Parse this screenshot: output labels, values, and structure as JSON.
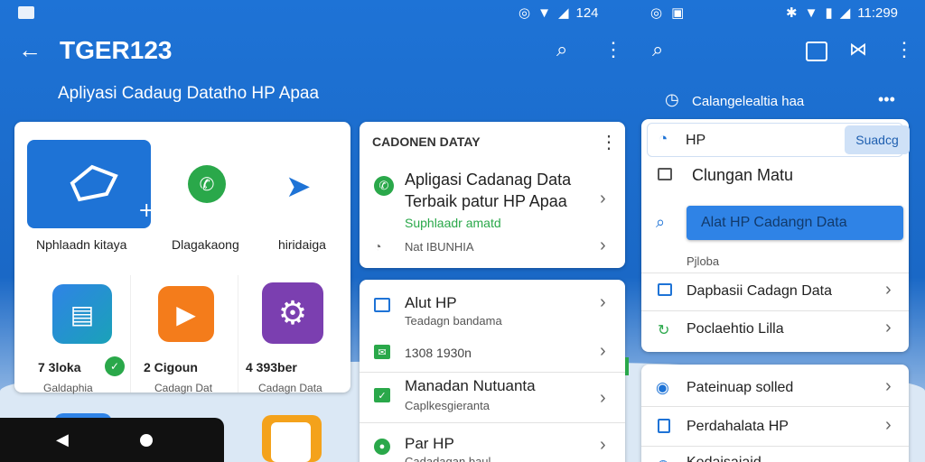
{
  "status_left": {
    "time": "124",
    "time_right": "11:299"
  },
  "left_app": {
    "title": "TGER123",
    "subtitle": "Apliyasi Cadaug Datatho HP Apaa",
    "tiles_row1": [
      {
        "label": "Nphlaadn kitaya"
      },
      {
        "label": "Dlagakaong"
      },
      {
        "label": "hiridaiga"
      }
    ],
    "tiles_row2": [
      {
        "count": "7 3loka",
        "sub": "Galdaphia"
      },
      {
        "count": "2 Cigoun",
        "sub": "Cadagn Dat"
      },
      {
        "count": "4 393ber",
        "sub": "Cadagn Data"
      }
    ]
  },
  "middle": {
    "card1": {
      "header": "CADONEN DATAY",
      "item1_line1": "Apligasi Cadanag Data",
      "item1_line2": "Terbaik patur HP Apaa",
      "item1_sub": "Suphlaadr amatd",
      "item2": "Nat IBUNHIA"
    },
    "card2": {
      "items": [
        {
          "title": "Alut HP",
          "sub": "Teadagn bandama"
        },
        {
          "title": "1308 1930n",
          "sub": ""
        },
        {
          "title": "Manadan Nutuanta",
          "sub": "Caplkesgieranta"
        },
        {
          "title": "Par HP",
          "sub": "Cadadagan baul"
        }
      ]
    }
  },
  "right": {
    "subtitle": "Calangelealtia haa",
    "search": {
      "value": "HP",
      "button": "Suadcg"
    },
    "menu_item": "Clungan Matu",
    "highlight": "Alat HP Cadangn Data",
    "section_label": "Pjloba",
    "list1": [
      "Dapbasii Cadagn Data",
      "Poclaehtio Lilla"
    ],
    "list2": [
      "Pateinuap solled",
      "Perdahalata HP",
      "Kedaisaiaid"
    ]
  },
  "colors": {
    "primary": "#1e73d6",
    "accent": "#2f83e6",
    "green": "#2aa84a"
  }
}
